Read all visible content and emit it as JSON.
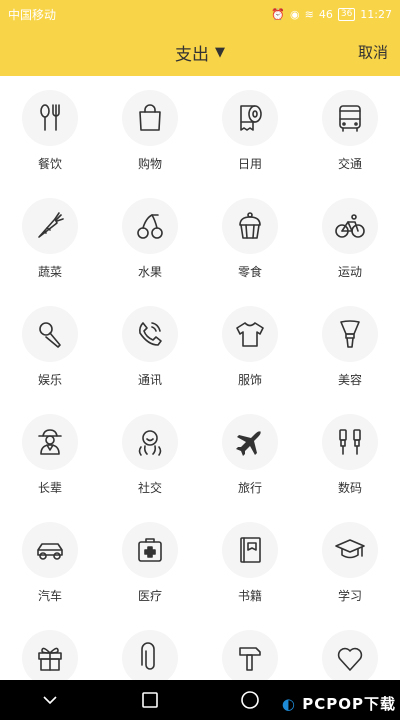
{
  "status_bar": {
    "carrier": "中国移动",
    "signal": "46",
    "battery": "36",
    "time": "11:27"
  },
  "header": {
    "title": "支出",
    "caret": "▼",
    "cancel_label": "取消"
  },
  "categories": [
    {
      "label": "餐饮",
      "icon": "utensils-icon"
    },
    {
      "label": "购物",
      "icon": "shopping-bag-icon"
    },
    {
      "label": "日用",
      "icon": "toilet-paper-icon"
    },
    {
      "label": "交通",
      "icon": "bus-icon"
    },
    {
      "label": "蔬菜",
      "icon": "carrot-icon"
    },
    {
      "label": "水果",
      "icon": "cherry-icon"
    },
    {
      "label": "零食",
      "icon": "cupcake-icon"
    },
    {
      "label": "运动",
      "icon": "bicycle-icon"
    },
    {
      "label": "娱乐",
      "icon": "microphone-icon"
    },
    {
      "label": "通讯",
      "icon": "phone-icon"
    },
    {
      "label": "服饰",
      "icon": "tshirt-icon"
    },
    {
      "label": "美容",
      "icon": "makeup-brush-icon"
    },
    {
      "label": "长辈",
      "icon": "elder-icon"
    },
    {
      "label": "社交",
      "icon": "social-icon"
    },
    {
      "label": "旅行",
      "icon": "airplane-icon"
    },
    {
      "label": "数码",
      "icon": "digital-icon"
    },
    {
      "label": "汽车",
      "icon": "car-icon"
    },
    {
      "label": "医疗",
      "icon": "medical-kit-icon"
    },
    {
      "label": "书籍",
      "icon": "book-icon"
    },
    {
      "label": "学习",
      "icon": "graduation-cap-icon"
    },
    {
      "label": "",
      "icon": "gift-icon"
    },
    {
      "label": "",
      "icon": "paperclip-icon"
    },
    {
      "label": "",
      "icon": "hammer-icon"
    },
    {
      "label": "",
      "icon": "heart-icon"
    }
  ],
  "watermark": {
    "text": "PCPOP下载"
  }
}
